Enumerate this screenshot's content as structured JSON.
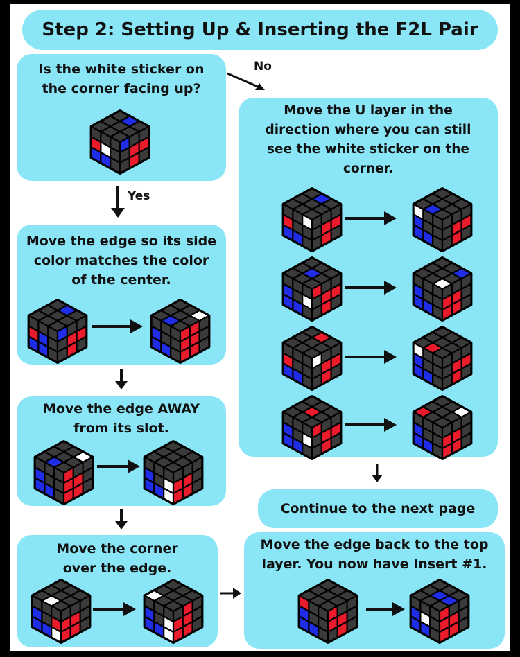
{
  "title": "Step 2: Setting Up & Inserting the F2L Pair",
  "labels": {
    "no": "No",
    "yes": "Yes"
  },
  "boxes": {
    "question": "Is the white sticker on the corner facing up?",
    "match_edge": "Move the edge so its side color matches the color of the center.",
    "edge_away": "Move the edge AWAY from its slot.",
    "corner_over": "Move the corner over the edge.",
    "move_u": "Move the U layer in the direction where you can still see the white sticker on the corner.",
    "continue": "Continue to the next page",
    "edge_back": "Move the edge back to the top layer. You now have Insert #1."
  },
  "colors": {
    "box": "#8ae6f6",
    "dark": "#3a3a3a",
    "red": "#ea1b2b",
    "blue": "#1f2ee6",
    "white": "#ffffff"
  },
  "icons": [
    "rubiks-cube-icon",
    "arrow-right-icon",
    "arrow-down-icon"
  ]
}
